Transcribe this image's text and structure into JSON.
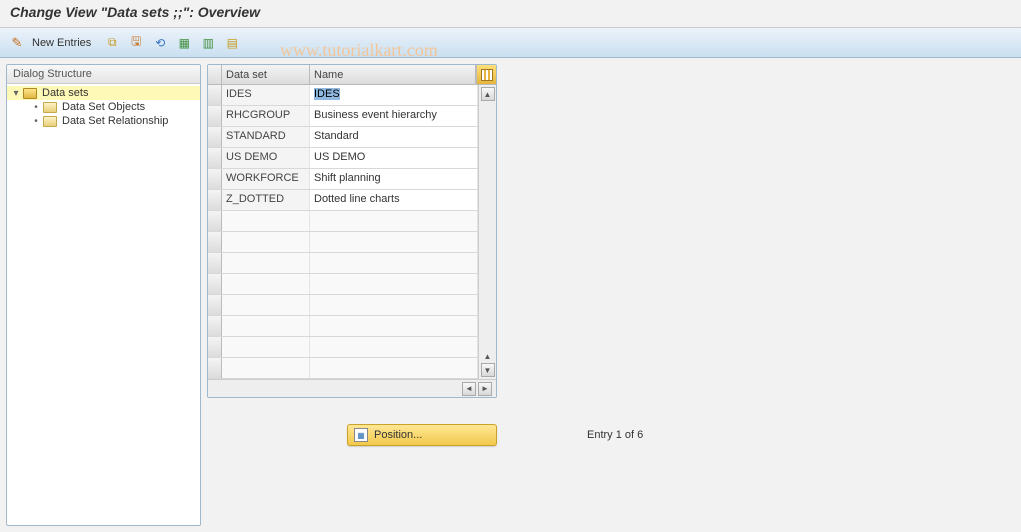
{
  "title": "Change View \"Data sets                 ;;\": Overview",
  "toolbar": {
    "new_entries_label": "New Entries"
  },
  "watermark": "www.tutorialkart.com",
  "sidebar": {
    "header": "Dialog Structure",
    "nodes": [
      {
        "label": "Data sets",
        "level": 1,
        "expanded": true,
        "selected": true,
        "open": true
      },
      {
        "label": "Data Set Objects",
        "level": 2,
        "expanded": false,
        "selected": false,
        "open": false
      },
      {
        "label": "Data Set Relationship",
        "level": 2,
        "expanded": false,
        "selected": false,
        "open": false
      }
    ]
  },
  "table": {
    "columns": {
      "c1": "Data set",
      "c2": "Name"
    },
    "rows": [
      {
        "dataset": "IDES",
        "name": "IDES",
        "name_selected": true
      },
      {
        "dataset": "RHCGROUP",
        "name": "Business event hierarchy"
      },
      {
        "dataset": "STANDARD",
        "name": "Standard"
      },
      {
        "dataset": "US DEMO",
        "name": "US DEMO"
      },
      {
        "dataset": "WORKFORCE",
        "name": "Shift planning"
      },
      {
        "dataset": "Z_DOTTED",
        "name": "Dotted line charts"
      }
    ],
    "empty_rows": 8
  },
  "footer": {
    "position_label": "Position...",
    "entry_text": "Entry 1 of 6"
  }
}
